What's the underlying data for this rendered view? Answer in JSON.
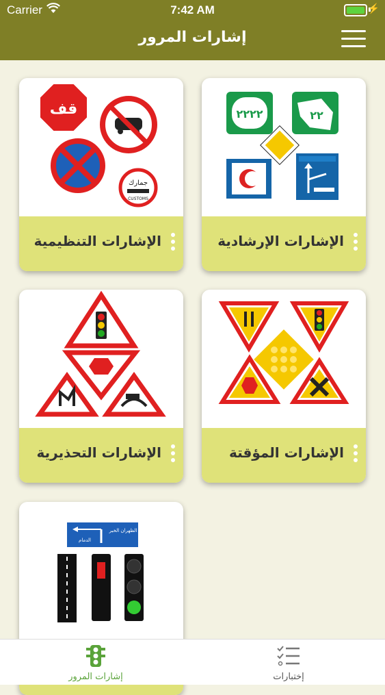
{
  "status": {
    "carrier": "Carrier",
    "time": "7:42 AM"
  },
  "header": {
    "title": "إشارات المرور"
  },
  "cards": [
    {
      "label": "الإشارات الإرشادية"
    },
    {
      "label": "الإشارات التنظيمية"
    },
    {
      "label": "الإشارات المؤقتة"
    },
    {
      "label": "الإشارات التحذيرية"
    },
    {
      "label": ""
    }
  ],
  "signs": {
    "stop_text": "قف",
    "customs_text": "جمارك",
    "customs_en": "CUSTOMS",
    "route_number": "٢٢٢٢",
    "map_number": "٢٢",
    "dir_label_1": "الظهران الخبر",
    "dir_label_2": "الدمام"
  },
  "tabbar": {
    "tabs": [
      {
        "label": "إشارات المرور",
        "active": true
      },
      {
        "label": "إختبارات",
        "active": false
      }
    ]
  },
  "colors": {
    "accent": "#7f7f26",
    "card_bar": "#dfe279",
    "background": "#f3f2e2"
  }
}
